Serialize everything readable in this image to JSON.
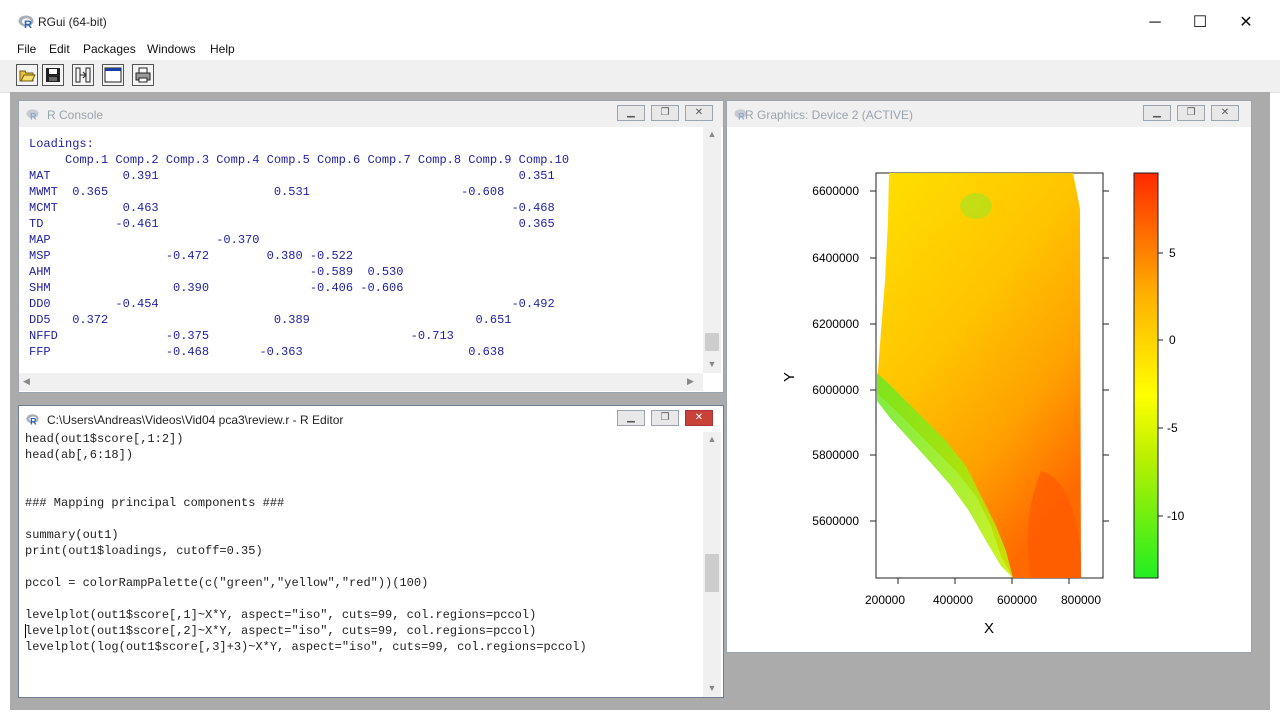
{
  "app": {
    "title": "RGui (64-bit)"
  },
  "window_controls": {
    "minimize": "─",
    "maximize": "☐",
    "close": "✕"
  },
  "menu": [
    "File",
    "Edit",
    "Packages",
    "Windows",
    "Help"
  ],
  "toolbar": {
    "buttons": [
      {
        "icon": "open-folder-icon"
      },
      {
        "icon": "save-icon"
      },
      {
        "icon": "load-workspace-icon"
      },
      {
        "icon": "console-window-icon"
      },
      {
        "icon": "print-icon"
      }
    ]
  },
  "console": {
    "title": "R Console",
    "lines": [
      "Loadings:",
      "     Comp.1 Comp.2 Comp.3 Comp.4 Comp.5 Comp.6 Comp.7 Comp.8 Comp.9 Comp.10",
      "MAT          0.391                                                  0.351",
      "MWMT  0.365                       0.531                     -0.608       ",
      "MCMT         0.463                                                 -0.468",
      "TD          -0.461                                                  0.365",
      "MAP                       -0.370                                         ",
      "MSP                -0.472        0.380 -0.522                            ",
      "AHM                                    -0.589  0.530                     ",
      "SHM                 0.390              -0.406 -0.606                     ",
      "DD0         -0.454                                                 -0.492",
      "DD5   0.372                       0.389                       0.651       ",
      "NFFD               -0.375                            -0.713              ",
      "FFP                -0.468       -0.363                       0.638              "
    ]
  },
  "editor": {
    "title": "C:\\Users\\Andreas\\Videos\\Vid04 pca3\\review.r - R Editor",
    "lines": [
      "head(out1$score[,1:2])",
      "head(ab[,6:18])",
      "",
      "",
      "### Mapping principal components ###",
      "",
      "summary(out1)",
      "print(out1$loadings, cutoff=0.35)",
      "",
      "pccol = colorRampPalette(c(\"green\",\"yellow\",\"red\"))(100)",
      "",
      "levelplot(out1$score[,1]~X*Y, aspect=\"iso\", cuts=99, col.regions=pccol)",
      "levelplot(out1$score[,2]~X*Y, aspect=\"iso\", cuts=99, col.regions=pccol)",
      "levelplot(log(out1$score[,3]+3)~X*Y, aspect=\"iso\", cuts=99, col.regions=pccol)"
    ]
  },
  "graphics": {
    "title": "R Graphics: Device 2 (ACTIVE)",
    "xlabel": "X",
    "ylabel": "Y",
    "x_ticks": [
      "200000",
      "400000",
      "600000",
      "800000"
    ],
    "y_ticks": [
      "6600000",
      "6400000",
      "6200000",
      "6000000",
      "5800000",
      "5600000"
    ],
    "colorbar_ticks": [
      "5",
      "0",
      "-5",
      "-10"
    ],
    "colors": {
      "low": "#00ff00",
      "mid": "#ffff00",
      "high": "#ff2a00"
    }
  }
}
